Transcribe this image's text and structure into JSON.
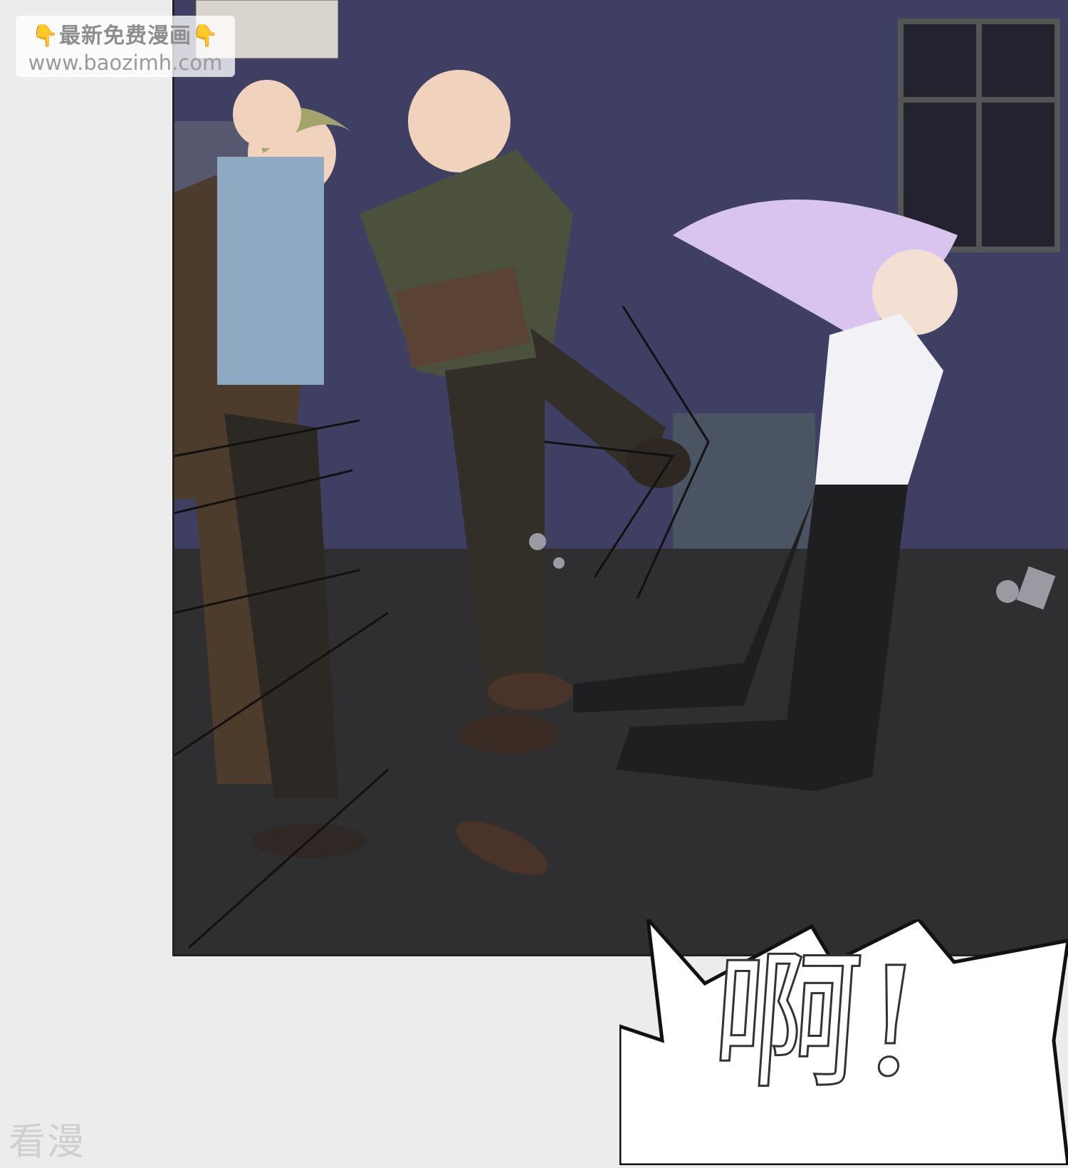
{
  "watermark": {
    "line1": "👇最新免费漫画👇",
    "line2": "www.baozimh.com"
  },
  "panel": {
    "scene": "manga-street-scene"
  },
  "sound_effect": {
    "text": "啊!"
  },
  "corner_mark": {
    "text": "看漫"
  },
  "colors": {
    "wall": "#3f3f63",
    "ground": "#2f2f31",
    "page": "#ececec",
    "hair": "#d8c4ee"
  }
}
